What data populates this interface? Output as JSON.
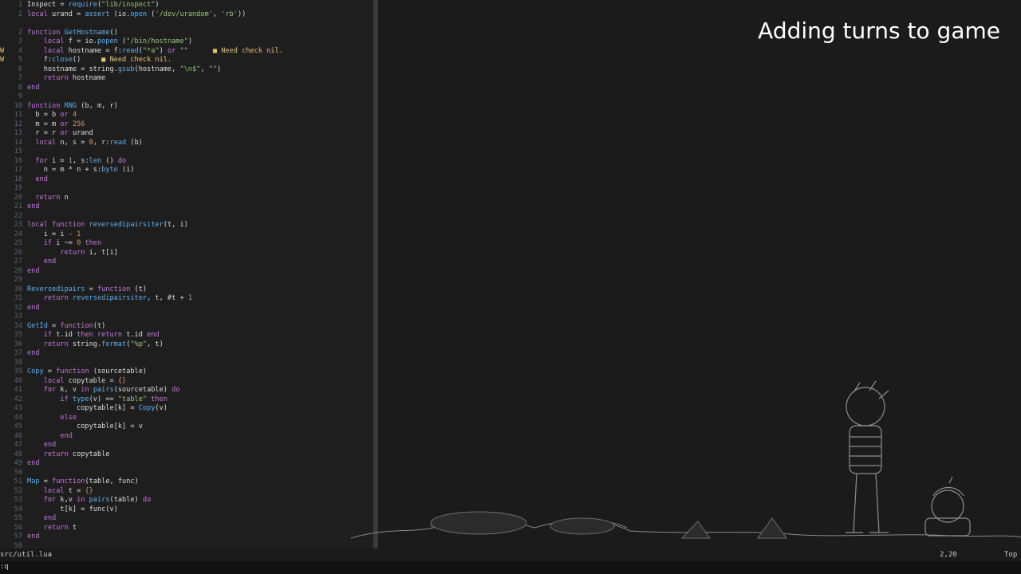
{
  "colors": {
    "keyword": "#c678dd",
    "function": "#61afef",
    "string": "#98c379",
    "number": "#d19a66",
    "text": "#dcdcdc",
    "comment_warn": "#e5c07b",
    "linenr": "#5c6370"
  },
  "video": {
    "title": "Adding turns to game"
  },
  "status": {
    "file": "src/util.lua",
    "position": "2,20",
    "scroll": "Top"
  },
  "cmdline": ":q",
  "editor": {
    "lines": [
      {
        "n": "1",
        "sign": "",
        "segs": [
          [
            "Inspect = ",
            ""
          ],
          [
            "require",
            "fn"
          ],
          [
            "(",
            ""
          ],
          [
            "\"lib/inspect\"",
            "str"
          ],
          [
            ")",
            ""
          ]
        ]
      },
      {
        "n": "2",
        "sign": "",
        "segs": [
          [
            "local ",
            "kw"
          ],
          [
            "urand = ",
            ""
          ],
          [
            "assert",
            "fn"
          ],
          [
            " (io.",
            ""
          ],
          [
            "open",
            "fn"
          ],
          [
            " (",
            ""
          ],
          [
            "'/dev/urandom'",
            "str"
          ],
          [
            ", ",
            ""
          ],
          [
            "'rb'",
            "str"
          ],
          [
            "))",
            ""
          ]
        ]
      },
      {
        "n": "",
        "sign": "",
        "segs": []
      },
      {
        "n": "2",
        "sign": "",
        "segs": [
          [
            "function ",
            "kw"
          ],
          [
            "GetHostname",
            "fn"
          ],
          [
            "()",
            ""
          ]
        ]
      },
      {
        "n": "3",
        "sign": "",
        "segs": [
          [
            "    local ",
            "kw"
          ],
          [
            "f = io.",
            ""
          ],
          [
            "popen",
            "fn"
          ],
          [
            " (",
            ""
          ],
          [
            "\"/bin/hostname\"",
            "str"
          ],
          [
            ")",
            ""
          ]
        ]
      },
      {
        "n": "4",
        "sign": "W",
        "segs": [
          [
            "    local ",
            "kw"
          ],
          [
            "hostname = f:",
            ""
          ],
          [
            "read",
            "fn"
          ],
          [
            "(",
            ""
          ],
          [
            "\"*a\"",
            "str"
          ],
          [
            ") ",
            ""
          ],
          [
            "or ",
            "kw"
          ],
          [
            "\"\"",
            "str"
          ],
          [
            "      ■ Need check nil.",
            "warn"
          ]
        ]
      },
      {
        "n": "5",
        "sign": "W",
        "segs": [
          [
            "    f:",
            ""
          ],
          [
            "close",
            "fn"
          ],
          [
            "()     ",
            ""
          ],
          [
            "■ Need check nil.",
            "warn"
          ]
        ]
      },
      {
        "n": "6",
        "sign": "",
        "segs": [
          [
            "    hostname = string.",
            ""
          ],
          [
            "gsub",
            "fn"
          ],
          [
            "(hostname, ",
            ""
          ],
          [
            "\"\\n$\"",
            "str"
          ],
          [
            ", ",
            ""
          ],
          [
            "\"\"",
            "str"
          ],
          [
            ")",
            ""
          ]
        ]
      },
      {
        "n": "7",
        "sign": "",
        "segs": [
          [
            "    return ",
            "kw"
          ],
          [
            "hostname",
            ""
          ]
        ]
      },
      {
        "n": "8",
        "sign": "",
        "segs": [
          [
            "end",
            "kw"
          ]
        ]
      },
      {
        "n": "9",
        "sign": "",
        "segs": []
      },
      {
        "n": "10",
        "sign": "",
        "segs": [
          [
            "function ",
            "kw"
          ],
          [
            "RNG",
            "fn"
          ],
          [
            " (b, m, r)",
            ""
          ]
        ]
      },
      {
        "n": "11",
        "sign": "",
        "segs": [
          [
            "  b = b ",
            ""
          ],
          [
            "or ",
            "kw"
          ],
          [
            "4",
            "num"
          ]
        ]
      },
      {
        "n": "12",
        "sign": "",
        "segs": [
          [
            "  m = m ",
            ""
          ],
          [
            "or ",
            "kw"
          ],
          [
            "256",
            "num"
          ]
        ]
      },
      {
        "n": "13",
        "sign": "",
        "segs": [
          [
            "  r = r ",
            ""
          ],
          [
            "or ",
            "kw"
          ],
          [
            "urand",
            ""
          ]
        ]
      },
      {
        "n": "14",
        "sign": "",
        "segs": [
          [
            "  local ",
            "kw"
          ],
          [
            "n, s = ",
            ""
          ],
          [
            "0",
            "num"
          ],
          [
            ", r:",
            ""
          ],
          [
            "read",
            "fn"
          ],
          [
            " (b)",
            ""
          ]
        ]
      },
      {
        "n": "15",
        "sign": "",
        "segs": []
      },
      {
        "n": "16",
        "sign": "",
        "segs": [
          [
            "  for ",
            "kw"
          ],
          [
            "i = ",
            ""
          ],
          [
            "1",
            "num"
          ],
          [
            ", s:",
            ""
          ],
          [
            "len",
            "fn"
          ],
          [
            " () ",
            ""
          ],
          [
            "do",
            "kw"
          ]
        ]
      },
      {
        "n": "17",
        "sign": "",
        "segs": [
          [
            "    n = m * n + s:",
            ""
          ],
          [
            "byte",
            "fn"
          ],
          [
            " (i)",
            ""
          ]
        ]
      },
      {
        "n": "18",
        "sign": "",
        "segs": [
          [
            "  end",
            "kw"
          ]
        ]
      },
      {
        "n": "19",
        "sign": "",
        "segs": []
      },
      {
        "n": "20",
        "sign": "",
        "segs": [
          [
            "  return ",
            "kw"
          ],
          [
            "n",
            ""
          ]
        ]
      },
      {
        "n": "21",
        "sign": "",
        "segs": [
          [
            "end",
            "kw"
          ]
        ]
      },
      {
        "n": "22",
        "sign": "",
        "segs": []
      },
      {
        "n": "23",
        "sign": "",
        "segs": [
          [
            "local function ",
            "kw"
          ],
          [
            "reversedipairsiter",
            "fn"
          ],
          [
            "(t, i)",
            ""
          ]
        ]
      },
      {
        "n": "24",
        "sign": "",
        "segs": [
          [
            "    i = i - ",
            ""
          ],
          [
            "1",
            "num"
          ]
        ]
      },
      {
        "n": "25",
        "sign": "",
        "segs": [
          [
            "    if ",
            "kw"
          ],
          [
            "i ~= ",
            ""
          ],
          [
            "0 ",
            "num"
          ],
          [
            "then",
            "kw"
          ]
        ]
      },
      {
        "n": "26",
        "sign": "",
        "segs": [
          [
            "        return ",
            "kw"
          ],
          [
            "i, t[i]",
            ""
          ]
        ]
      },
      {
        "n": "27",
        "sign": "",
        "segs": [
          [
            "    end",
            "kw"
          ]
        ]
      },
      {
        "n": "28",
        "sign": "",
        "segs": [
          [
            "end",
            "kw"
          ]
        ]
      },
      {
        "n": "29",
        "sign": "",
        "segs": []
      },
      {
        "n": "30",
        "sign": "",
        "segs": [
          [
            "Reversedipairs",
            "fn"
          ],
          [
            " = ",
            ""
          ],
          [
            "function ",
            "kw"
          ],
          [
            "(t)",
            ""
          ]
        ]
      },
      {
        "n": "31",
        "sign": "",
        "segs": [
          [
            "    return ",
            "kw"
          ],
          [
            "reversedipairsiter",
            "fn"
          ],
          [
            ", t, #t + ",
            ""
          ],
          [
            "1",
            "num"
          ]
        ]
      },
      {
        "n": "32",
        "sign": "",
        "segs": [
          [
            "end",
            "kw"
          ]
        ]
      },
      {
        "n": "33",
        "sign": "",
        "segs": []
      },
      {
        "n": "34",
        "sign": "",
        "segs": [
          [
            "GetId",
            "fn"
          ],
          [
            " = ",
            ""
          ],
          [
            "function",
            "kw"
          ],
          [
            "(t)",
            ""
          ]
        ]
      },
      {
        "n": "35",
        "sign": "",
        "segs": [
          [
            "    if ",
            "kw"
          ],
          [
            "t.id ",
            ""
          ],
          [
            "then return ",
            "kw"
          ],
          [
            "t.id ",
            ""
          ],
          [
            "end",
            "kw"
          ]
        ]
      },
      {
        "n": "36",
        "sign": "",
        "segs": [
          [
            "    return ",
            "kw"
          ],
          [
            "string.",
            ""
          ],
          [
            "format",
            "fn"
          ],
          [
            "(",
            ""
          ],
          [
            "\"%p\"",
            "str"
          ],
          [
            ", t)",
            ""
          ]
        ]
      },
      {
        "n": "37",
        "sign": "",
        "segs": [
          [
            "end",
            "kw"
          ]
        ]
      },
      {
        "n": "38",
        "sign": "",
        "segs": []
      },
      {
        "n": "39",
        "sign": "",
        "segs": [
          [
            "Copy",
            "fn"
          ],
          [
            " = ",
            ""
          ],
          [
            "function ",
            "kw"
          ],
          [
            "(sourcetable)",
            ""
          ]
        ]
      },
      {
        "n": "40",
        "sign": "",
        "segs": [
          [
            "    local ",
            "kw"
          ],
          [
            "copytable = ",
            ""
          ],
          [
            "{}",
            "num"
          ]
        ]
      },
      {
        "n": "41",
        "sign": "",
        "segs": [
          [
            "    for ",
            "kw"
          ],
          [
            "k, v ",
            ""
          ],
          [
            "in ",
            "kw"
          ],
          [
            "pairs",
            "fn"
          ],
          [
            "(sourcetable) ",
            ""
          ],
          [
            "do",
            "kw"
          ]
        ]
      },
      {
        "n": "42",
        "sign": "",
        "segs": [
          [
            "        if ",
            "kw"
          ],
          [
            "type",
            "fn"
          ],
          [
            "(v) == ",
            ""
          ],
          [
            "\"table\" ",
            "str"
          ],
          [
            "then",
            "kw"
          ]
        ]
      },
      {
        "n": "43",
        "sign": "",
        "segs": [
          [
            "            copytable[k] = ",
            ""
          ],
          [
            "Copy",
            "fn"
          ],
          [
            "(v)",
            ""
          ]
        ]
      },
      {
        "n": "44",
        "sign": "",
        "segs": [
          [
            "        else",
            "kw"
          ]
        ]
      },
      {
        "n": "45",
        "sign": "",
        "segs": [
          [
            "            copytable[k] = v",
            ""
          ]
        ]
      },
      {
        "n": "46",
        "sign": "",
        "segs": [
          [
            "        end",
            "kw"
          ]
        ]
      },
      {
        "n": "47",
        "sign": "",
        "segs": [
          [
            "    end",
            "kw"
          ]
        ]
      },
      {
        "n": "48",
        "sign": "",
        "segs": [
          [
            "    return ",
            "kw"
          ],
          [
            "copytable",
            ""
          ]
        ]
      },
      {
        "n": "49",
        "sign": "",
        "segs": [
          [
            "end",
            "kw"
          ]
        ]
      },
      {
        "n": "50",
        "sign": "",
        "segs": []
      },
      {
        "n": "51",
        "sign": "",
        "segs": [
          [
            "Map",
            "fn"
          ],
          [
            " = ",
            ""
          ],
          [
            "function",
            "kw"
          ],
          [
            "(table, func)",
            ""
          ]
        ]
      },
      {
        "n": "52",
        "sign": "",
        "segs": [
          [
            "    local ",
            "kw"
          ],
          [
            "t = ",
            ""
          ],
          [
            "{}",
            "num"
          ]
        ]
      },
      {
        "n": "53",
        "sign": "",
        "segs": [
          [
            "    for ",
            "kw"
          ],
          [
            "k,v ",
            ""
          ],
          [
            "in ",
            "kw"
          ],
          [
            "pairs",
            "fn"
          ],
          [
            "(table) ",
            ""
          ],
          [
            "do",
            "kw"
          ]
        ]
      },
      {
        "n": "54",
        "sign": "",
        "segs": [
          [
            "        t[k] = func(v)",
            ""
          ]
        ]
      },
      {
        "n": "55",
        "sign": "",
        "segs": [
          [
            "    end",
            "kw"
          ]
        ]
      },
      {
        "n": "56",
        "sign": "",
        "segs": [
          [
            "    return ",
            "kw"
          ],
          [
            "t",
            ""
          ]
        ]
      },
      {
        "n": "57",
        "sign": "",
        "segs": [
          [
            "end",
            "kw"
          ]
        ]
      },
      {
        "n": "58",
        "sign": "",
        "segs": []
      }
    ]
  }
}
